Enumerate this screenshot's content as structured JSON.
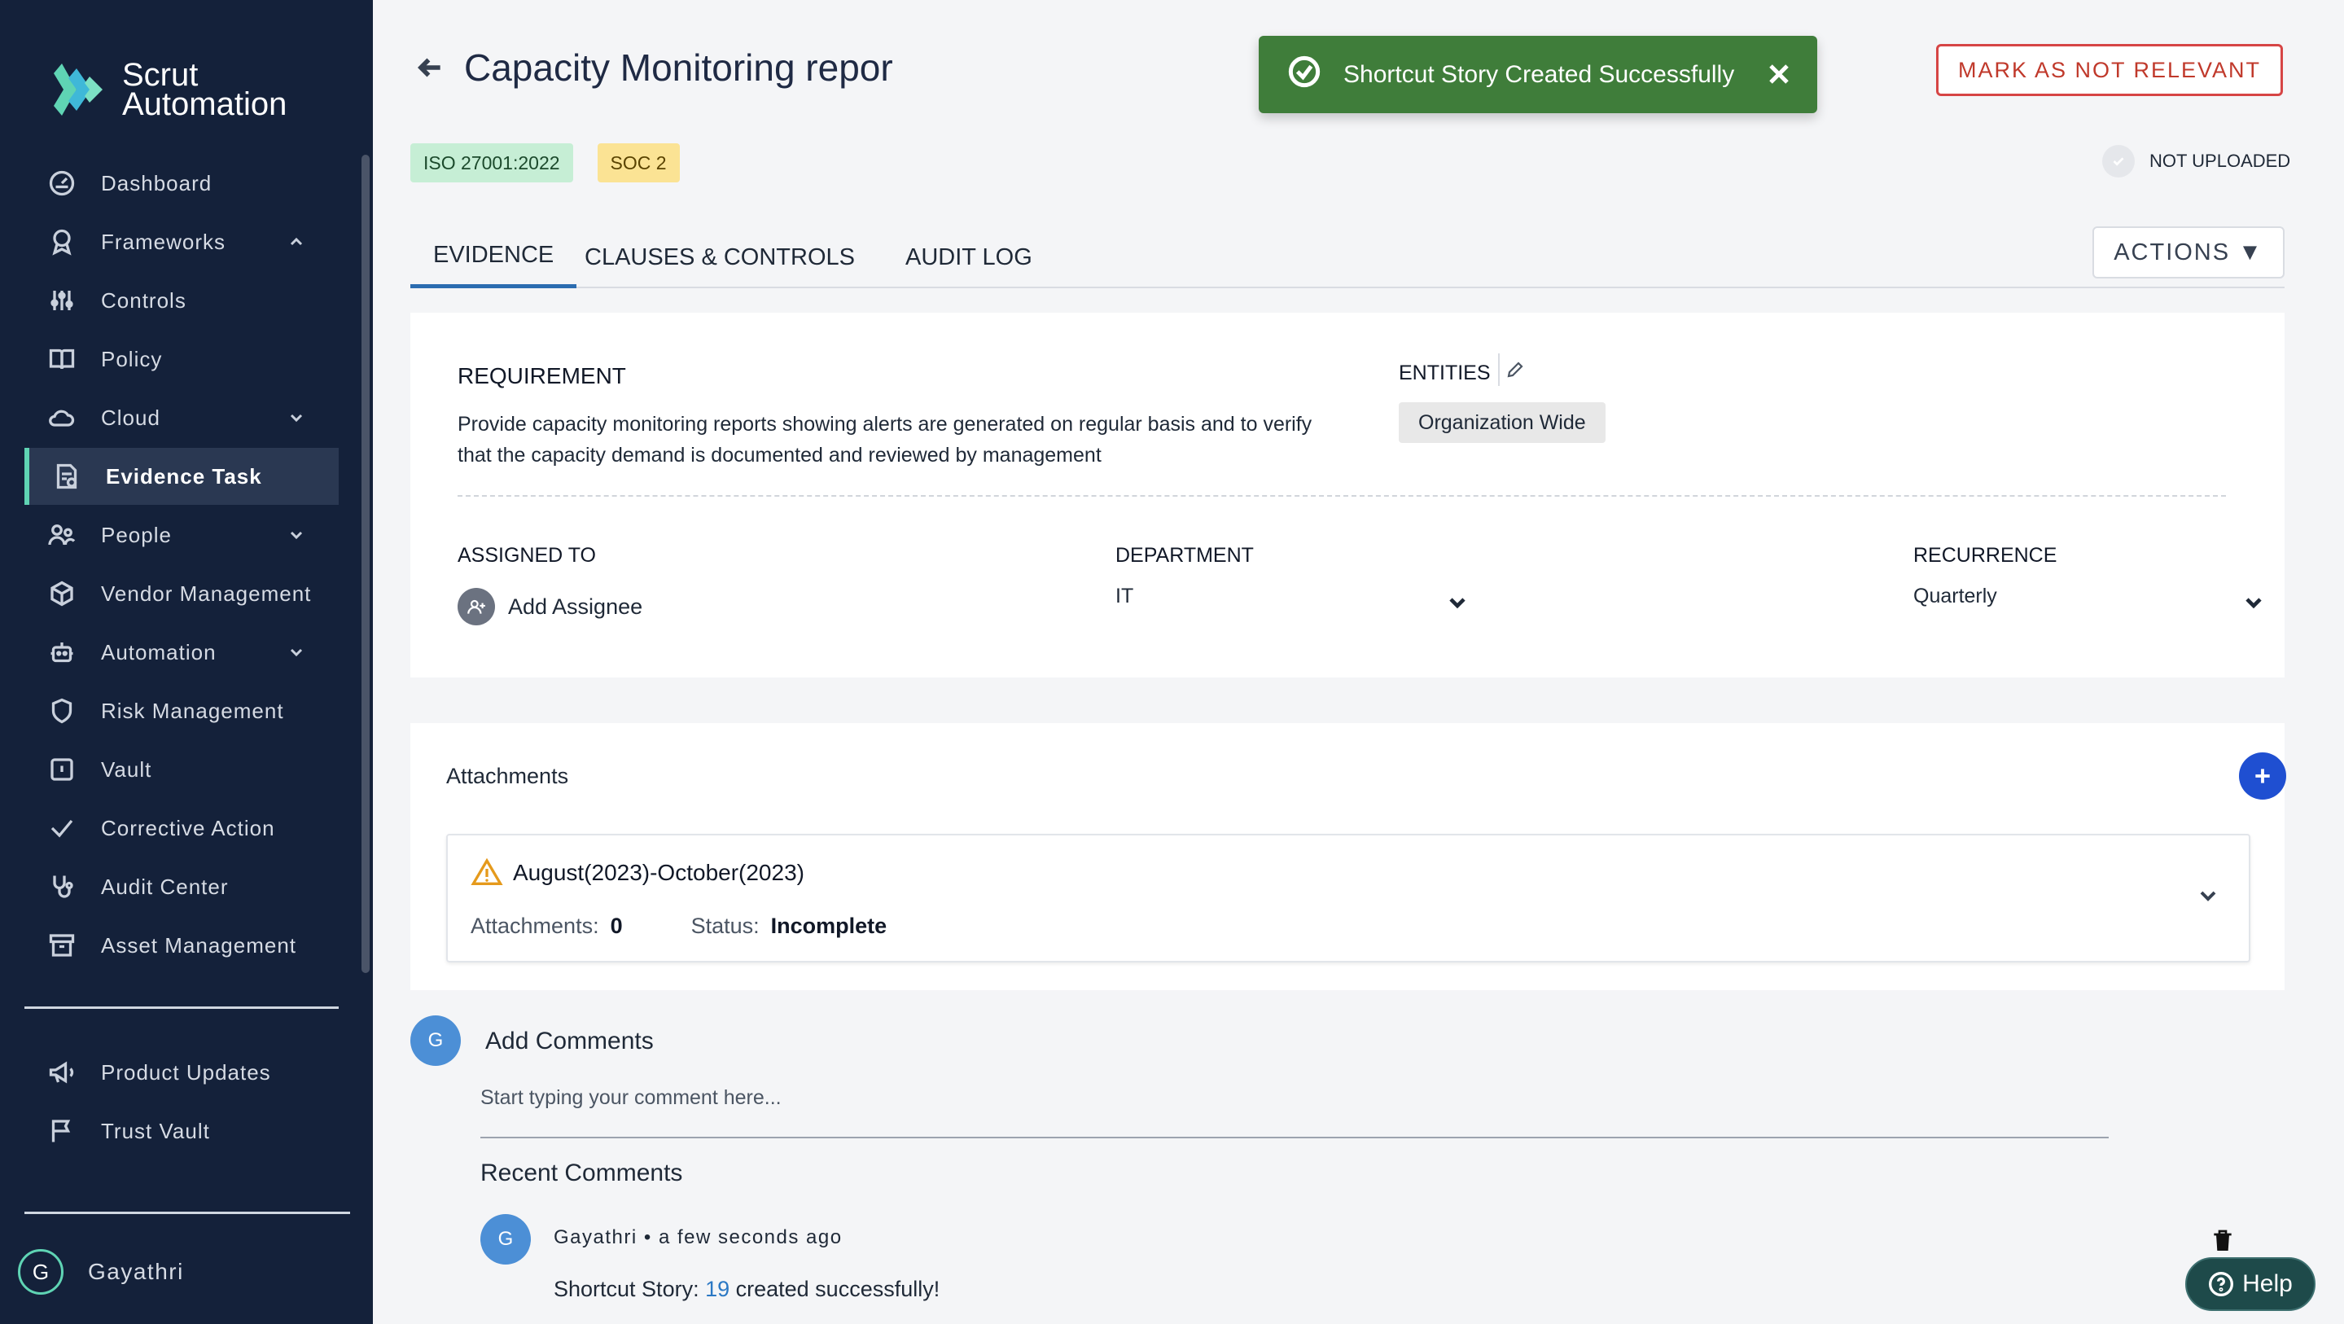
{
  "brand": {
    "line1": "Scrut",
    "line2": "Automation"
  },
  "sidebar": {
    "items": [
      {
        "label": "Dashboard",
        "icon": "dashboard-icon"
      },
      {
        "label": "Frameworks",
        "icon": "frameworks-icon",
        "chevron": "up"
      },
      {
        "label": "Controls",
        "icon": "controls-icon"
      },
      {
        "label": "Policy",
        "icon": "policy-icon"
      },
      {
        "label": "Cloud",
        "icon": "cloud-icon",
        "chevron": "down"
      },
      {
        "label": "Evidence Task",
        "icon": "evidence-task-icon",
        "active": true
      },
      {
        "label": "People",
        "icon": "people-icon",
        "chevron": "down"
      },
      {
        "label": "Vendor Management",
        "icon": "vendor-icon"
      },
      {
        "label": "Automation",
        "icon": "automation-icon",
        "chevron": "down"
      },
      {
        "label": "Risk Management",
        "icon": "shield-icon"
      },
      {
        "label": "Vault",
        "icon": "vault-icon"
      },
      {
        "label": "Corrective Action",
        "icon": "check-icon"
      },
      {
        "label": "Audit Center",
        "icon": "stethoscope-icon"
      },
      {
        "label": "Asset Management",
        "icon": "archive-icon"
      }
    ],
    "secondary": [
      {
        "label": "Product Updates",
        "icon": "megaphone-icon"
      },
      {
        "label": "Trust Vault",
        "icon": "flag-icon"
      }
    ],
    "user": {
      "initial": "G",
      "name": "Gayathri"
    }
  },
  "header": {
    "title": "Capacity Monitoring repor",
    "mark_button": "MARK AS NOT RELEVANT",
    "upload_status": "NOT UPLOADED"
  },
  "toast": {
    "message": "Shortcut Story Created Successfully"
  },
  "tags": [
    "ISO 27001:2022",
    "SOC 2"
  ],
  "tabs": [
    {
      "label": "EVIDENCE",
      "active": true
    },
    {
      "label": "CLAUSES & CONTROLS"
    },
    {
      "label": "AUDIT LOG"
    }
  ],
  "actions_label": "ACTIONS",
  "requirement": {
    "title": "REQUIREMENT",
    "text": "Provide capacity monitoring reports showing alerts are generated on regular basis and to verify that the capacity demand is documented and reviewed by management",
    "entities_title": "ENTITIES",
    "entity": "Organization Wide",
    "assigned_label": "ASSIGNED TO",
    "assigned_value": "Add Assignee",
    "department_label": "DEPARTMENT",
    "department_value": "IT",
    "recurrence_label": "RECURRENCE",
    "recurrence_value": "Quarterly"
  },
  "attachments": {
    "title": "Attachments",
    "period": "August(2023)-October(2023)",
    "count_label": "Attachments:",
    "count_value": "0",
    "status_label": "Status:",
    "status_value": "Incomplete"
  },
  "comments": {
    "avatar_initial": "G",
    "title": "Add Comments",
    "placeholder": "Start typing your comment here...",
    "recent_title": "Recent Comments",
    "items": [
      {
        "initial": "G",
        "author_line": "Gayathri • a few seconds ago",
        "text_prefix": "Shortcut Story: ",
        "link": "19",
        "text_suffix": " created successfully!"
      }
    ]
  },
  "help_label": "Help",
  "colors": {
    "sidebar_bg": "#14213a",
    "accent_green": "#5fd4b4",
    "toast_bg": "#3f7d3a",
    "danger": "#d64545",
    "primary": "#1f4fd1"
  }
}
